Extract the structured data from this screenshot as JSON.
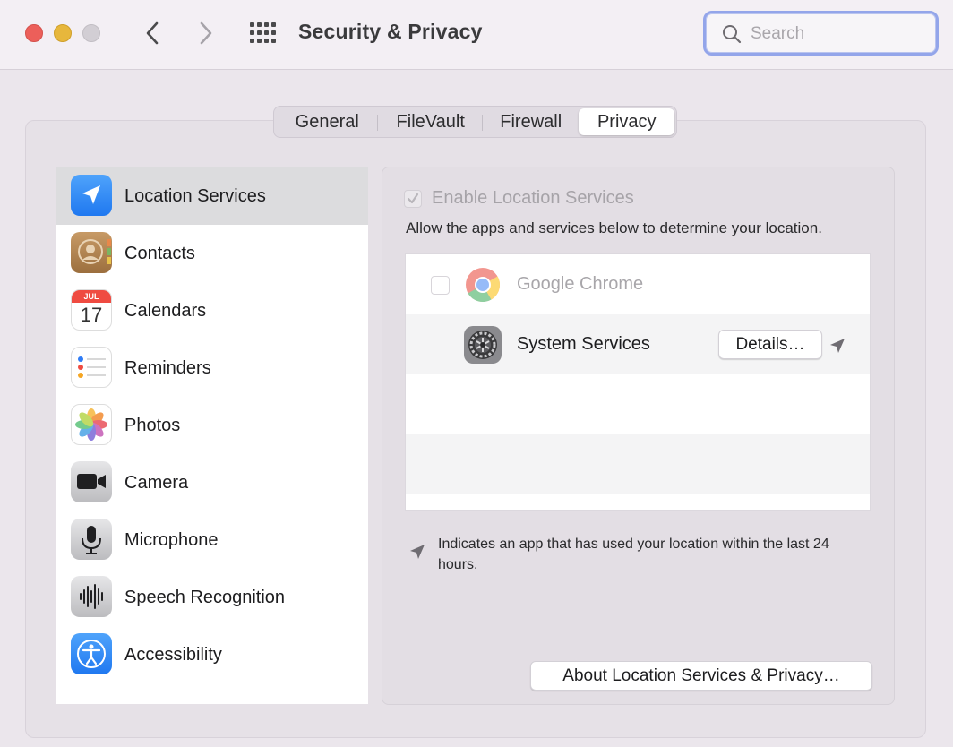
{
  "window": {
    "title": "Security & Privacy",
    "search_placeholder": "Search"
  },
  "tabs": [
    {
      "label": "General"
    },
    {
      "label": "FileVault"
    },
    {
      "label": "Firewall"
    },
    {
      "label": "Privacy",
      "active": true
    }
  ],
  "sidebar": {
    "items": [
      {
        "label": "Location Services",
        "icon": "location-arrow-icon",
        "selected": true
      },
      {
        "label": "Contacts",
        "icon": "contacts-icon"
      },
      {
        "label": "Calendars",
        "icon": "calendar-icon",
        "month": "JUL",
        "day": "17"
      },
      {
        "label": "Reminders",
        "icon": "reminders-icon"
      },
      {
        "label": "Photos",
        "icon": "photos-icon"
      },
      {
        "label": "Camera",
        "icon": "camera-icon"
      },
      {
        "label": "Microphone",
        "icon": "microphone-icon"
      },
      {
        "label": "Speech Recognition",
        "icon": "speech-waveform-icon"
      },
      {
        "label": "Accessibility",
        "icon": "accessibility-icon"
      }
    ]
  },
  "location": {
    "enable_label": "Enable Location Services",
    "enable_checked": true,
    "enable_disabled": true,
    "allow_text": "Allow the apps and services below to determine your location.",
    "apps": [
      {
        "name": "Google Chrome",
        "checked": false,
        "disabled": true,
        "icon": "chrome-icon"
      },
      {
        "name": "System Services",
        "icon": "system-preferences-gear-icon",
        "details_label": "Details…",
        "recent_use": true
      }
    ],
    "legend_text": "Indicates an app that has used your location within the last 24 hours.",
    "about_label": "About Location Services & Privacy…"
  },
  "colors": {
    "accent": "#3b82f6",
    "search_focus": "#93a5ea",
    "close": "#ec5f5a",
    "minimize": "#e7b73c",
    "maximize": "#d2ced4"
  }
}
